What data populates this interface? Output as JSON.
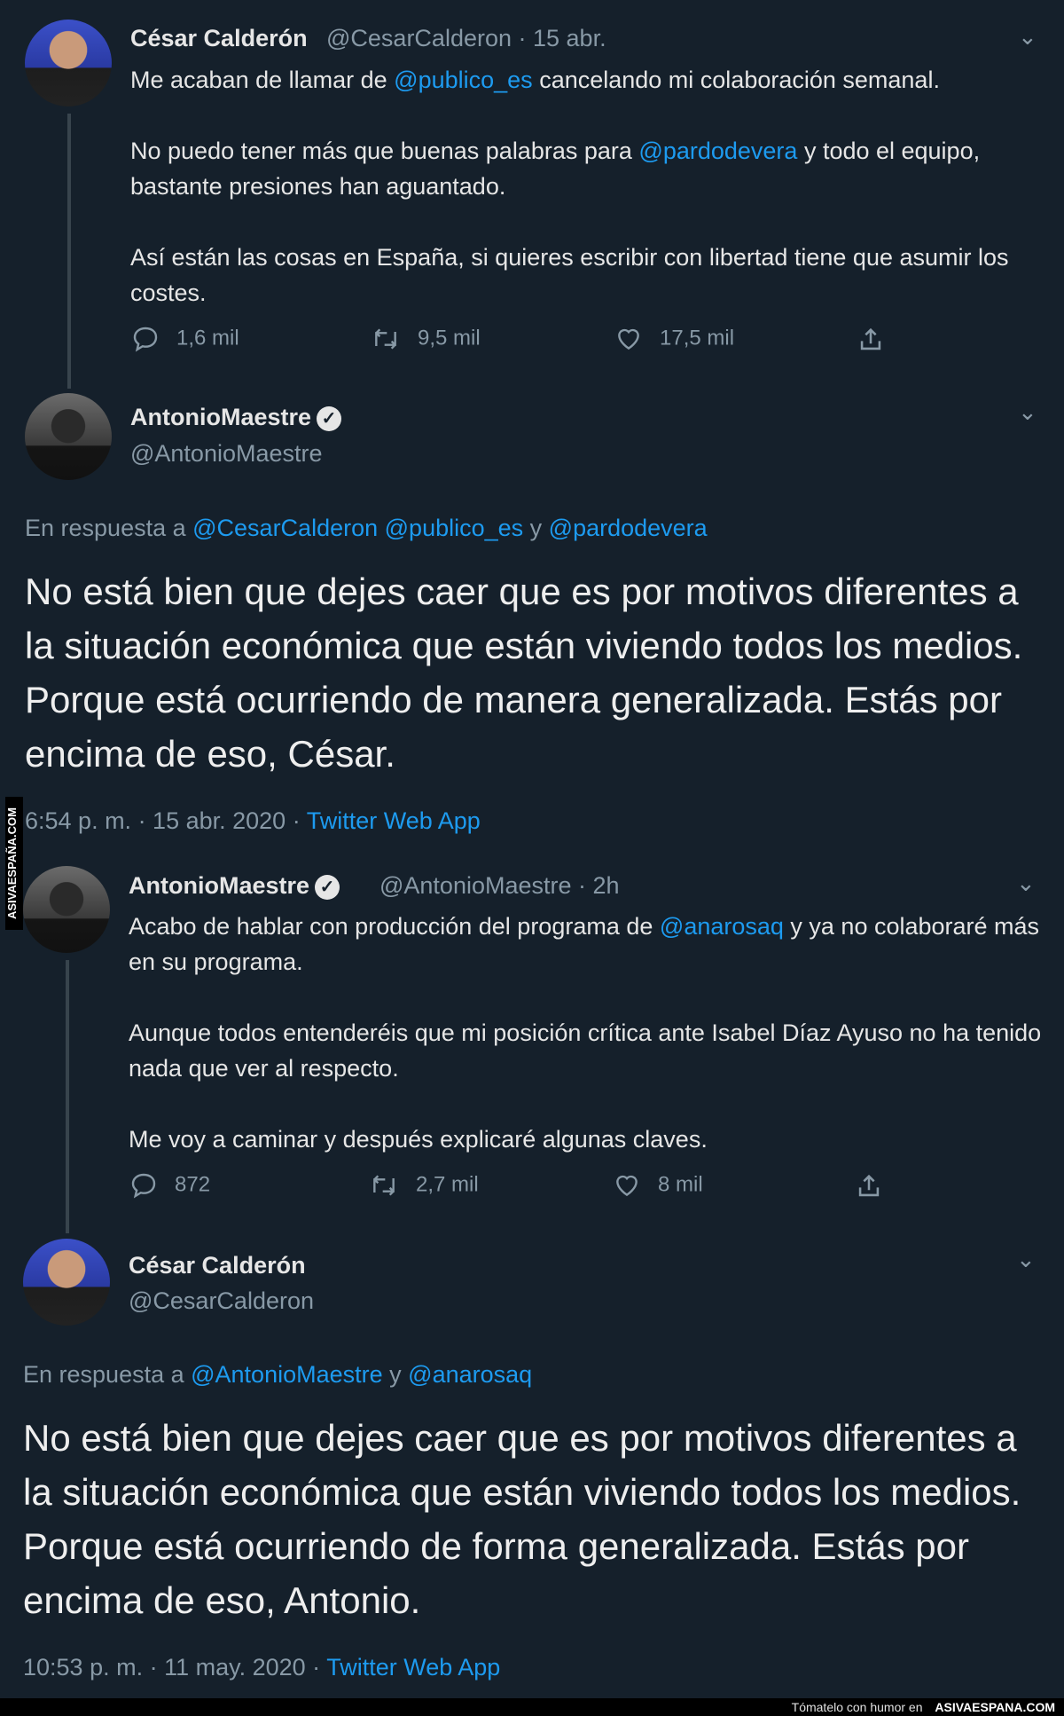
{
  "tweet1": {
    "name": "César Calderón",
    "handle": "@CesarCalderon",
    "date": "· 15 abr.",
    "line1_pre": "Me acaban de llamar de ",
    "line1_link": "@publico_es",
    "line1_post": " cancelando mi colaboración semanal.",
    "p2_pre": "No puedo tener más que buenas palabras para ",
    "p2_link": "@pardodevera",
    "p2_post": "  y todo el equipo, bastante presiones han aguantado.",
    "p3": "Así están las cosas en España, si quieres escribir con libertad tiene que asumir los costes.",
    "replies": "1,6 mil",
    "retweets": "9,5 mil",
    "likes": "17,5 mil"
  },
  "tweet2": {
    "name": "AntonioMaestre",
    "handle": "@AntonioMaestre",
    "reply_prefix": "En respuesta a ",
    "reply_link1": "@CesarCalderon",
    "reply_link2": "@publico_es",
    "reply_conj": " y ",
    "reply_link3": "@pardodevera",
    "text": "No está bien que dejes caer que es por motivos diferentes a la situación económica que están viviendo todos los medios. Porque está ocurriendo de manera generalizada. Estás por encima de eso, César.",
    "timestamp": "6:54 p. m. · 15 abr. 2020 · ",
    "source": "Twitter Web App"
  },
  "tweet3": {
    "name": "AntonioMaestre",
    "handle": "@AntonioMaestre · 2h",
    "p1_pre": "Acabo de hablar con producción del programa de ",
    "p1_link": "@anarosaq",
    "p1_post": " y ya no colaboraré más en su programa.",
    "p2": "Aunque todos entenderéis que mi posición crítica ante Isabel Díaz Ayuso no ha tenido nada que ver al respecto.",
    "p3": "Me voy a caminar y después explicaré algunas claves.",
    "replies": "872",
    "retweets": "2,7 mil",
    "likes": "8 mil"
  },
  "tweet4": {
    "name": "César Calderón",
    "handle": "@CesarCalderon",
    "reply_prefix": "En respuesta a ",
    "reply_link1": "@AntonioMaestre",
    "reply_conj": " y ",
    "reply_link2": "@anarosaq",
    "text": "No está bien que dejes caer que es por motivos diferentes a la situación económica que están viviendo todos los medios. Porque está ocurriendo de forma generalizada. Estás por encima de eso, Antonio.",
    "timestamp": "10:53 p. m. · 11 may. 2020 · ",
    "source": "Twitter Web App"
  },
  "watermark": {
    "side": "ASIVAESPAÑA.COM",
    "footer_text": "Tómatelo con humor en ",
    "footer_brand": "ASIVAESPANA.COM"
  },
  "icons": {
    "verified": "verified-badge-icon",
    "chevron": "chevron-down-icon",
    "reply": "reply-icon",
    "retweet": "retweet-icon",
    "like": "heart-icon",
    "share": "share-icon"
  }
}
